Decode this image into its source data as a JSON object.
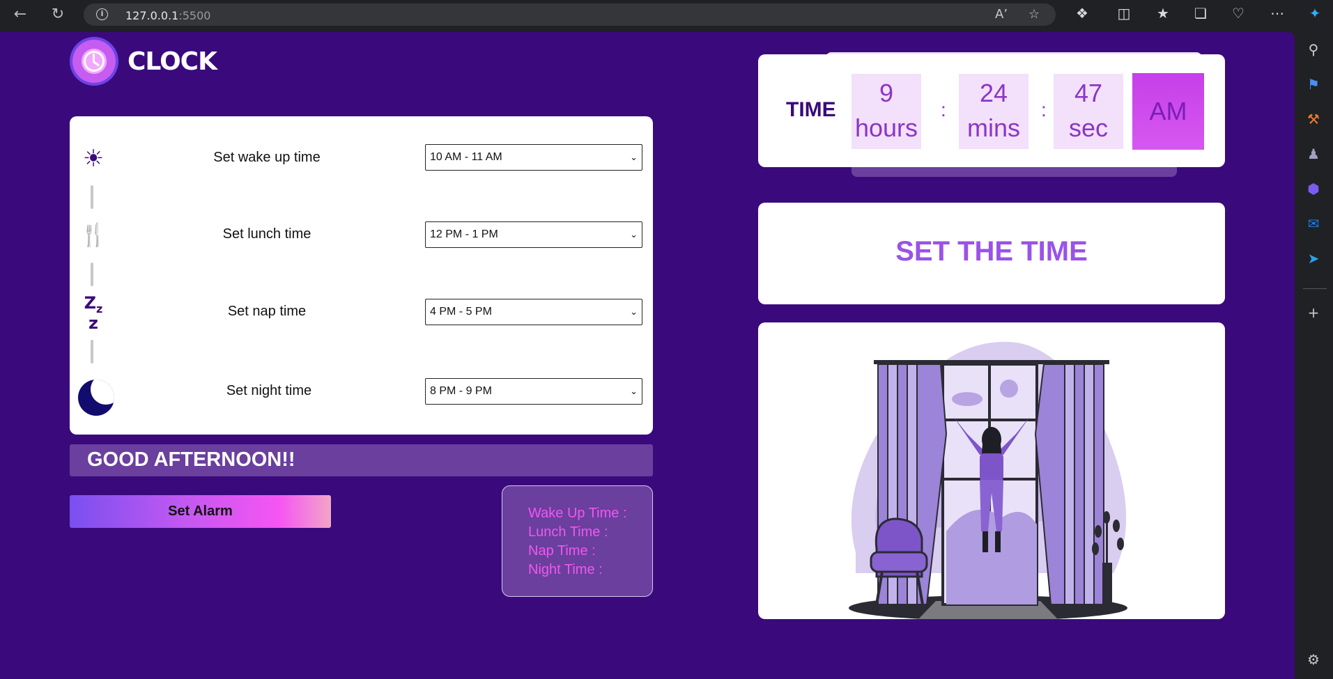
{
  "browser": {
    "url_host": "127.0.0.1",
    "url_port": ":5500"
  },
  "app": {
    "brand": "CLOCK"
  },
  "schedule": {
    "rows": [
      {
        "label": "Set wake up time",
        "value": "10 AM - 11 AM",
        "icon": "sun-icon"
      },
      {
        "label": "Set lunch time",
        "value": "12 PM - 1 PM",
        "icon": "fork-spoon-icon"
      },
      {
        "label": "Set nap time",
        "value": "4 PM - 5 PM",
        "icon": "zzz-icon"
      },
      {
        "label": "Set night time",
        "value": "8 PM - 9 PM",
        "icon": "moon-icon"
      }
    ]
  },
  "greeting": "GOOD AFTERNOON!!",
  "alarm_button": "Set Alarm",
  "summary": {
    "wake": "Wake Up Time :",
    "lunch": "Lunch Time :",
    "nap": "Nap Time :",
    "night": "Night Time :"
  },
  "clock": {
    "label": "TIME",
    "hours_value": "9",
    "hours_unit": "hours",
    "mins_value": "24",
    "mins_unit": "mins",
    "sec_value": "47",
    "sec_unit": "sec",
    "sep": ":",
    "ampm": "AM"
  },
  "set_time_title": "SET THE TIME",
  "colors": {
    "page_bg": "#3a0a7c",
    "accent": "#9a52e8",
    "pink": "#f256ef"
  }
}
